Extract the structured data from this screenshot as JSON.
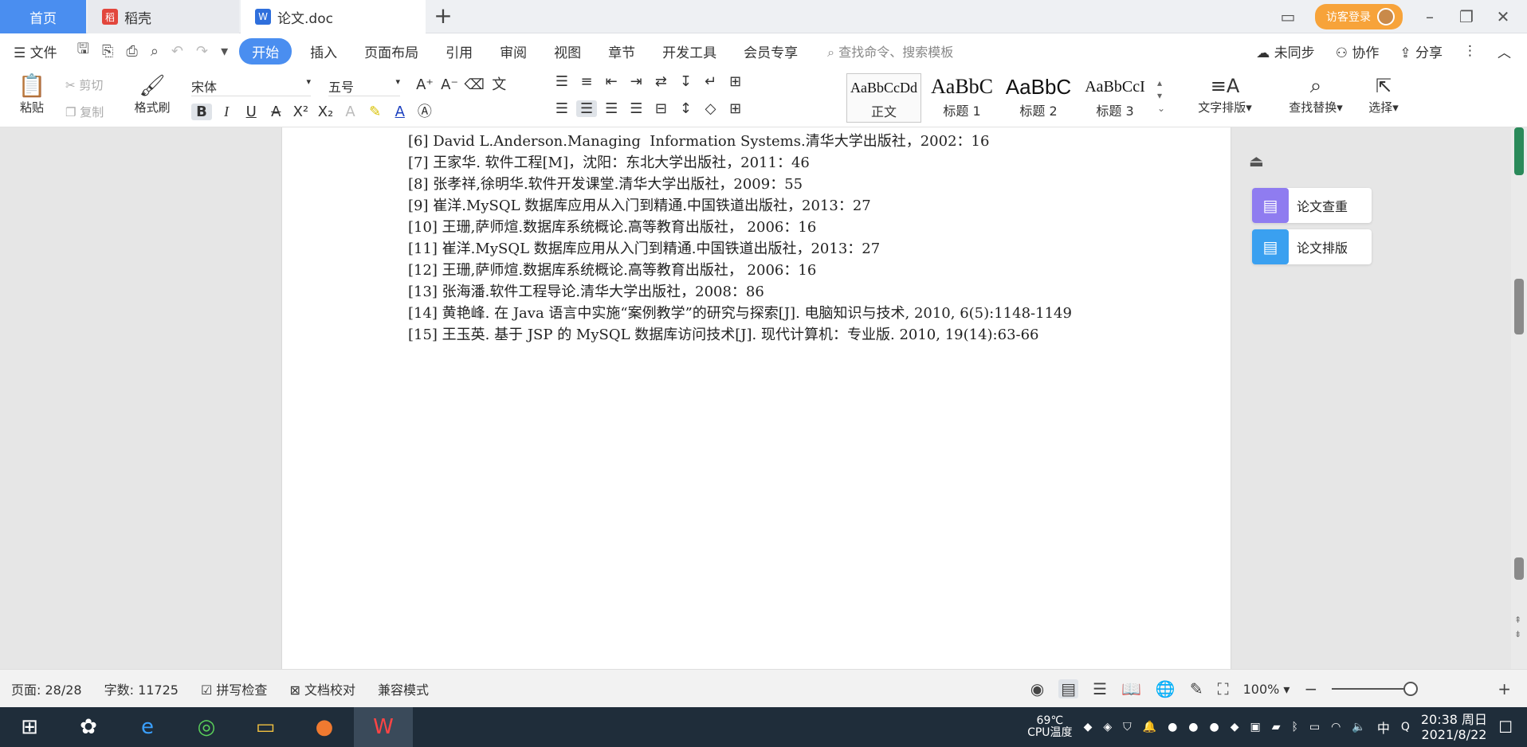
{
  "tabs": {
    "home": "首页",
    "daoke": "稻壳",
    "doc": "论文.doc",
    "new_tab": "+"
  },
  "account": {
    "label": "访客登录"
  },
  "menu": {
    "file": "文件",
    "items": [
      "开始",
      "插入",
      "页面布局",
      "引用",
      "审阅",
      "视图",
      "章节",
      "开发工具",
      "会员专享"
    ],
    "search_placeholder": "查找命令、搜索模板",
    "sync": "未同步",
    "collab": "协作",
    "share": "分享"
  },
  "ribbon": {
    "paste": "粘贴",
    "cut": "剪切",
    "copy": "复制",
    "format_painter": "格式刷",
    "font_name": "宋体",
    "font_size": "五号",
    "styles": [
      {
        "preview": "AaBbCcDd",
        "label": "正文"
      },
      {
        "preview": "AaBbC",
        "label": "标题 1"
      },
      {
        "preview": "AaBbC",
        "label": "标题 2"
      },
      {
        "preview": "AaBbCcI",
        "label": "标题 3"
      }
    ],
    "text_layout": "文字排版",
    "find_replace": "查找替换",
    "select": "选择"
  },
  "document": {
    "references": [
      "[6] David L.Anderson.Managing  Information Systems.清华大学出版社，2002：16",
      "[7] 王家华. 软件工程[M]，沈阳：东北大学出版社，2011：46",
      "[8] 张孝祥,徐明华.软件开发课堂.清华大学出版社，2009：55",
      "[9] 崔洋.MySQL 数据库应用从入门到精通.中国铁道出版社，2013：27",
      "[10] 王珊,萨师煊.数据库系统概论.高等教育出版社， 2006：16",
      "[11] 崔洋.MySQL 数据库应用从入门到精通.中国铁道出版社，2013：27",
      "[12] 王珊,萨师煊.数据库系统概论.高等教育出版社， 2006：16",
      "[13] 张海潘.软件工程导论.清华大学出版社，2008：86",
      "[14] 黄艳峰. 在 Java 语言中实施“案例教学”的研究与探索[J]. 电脑知识与技术, 2010, 6(5):1148-1149",
      "[15] 王玉英. 基于 JSP 的 MySQL 数据库访问技术[J]. 现代计算机：专业版. 2010, 19(14):63-66"
    ]
  },
  "side_panel": {
    "check": "论文查重",
    "format": "论文排版"
  },
  "status": {
    "page": "页面: 28/28",
    "words": "字数: 11725",
    "spell": "拼写检查",
    "proof": "文档校对",
    "compat": "兼容模式",
    "zoom": "100%"
  },
  "taskbar": {
    "cpu_temp": "69℃",
    "cpu_label": "CPU温度",
    "ime": "中",
    "time": "20:38 周日",
    "date": "2021/8/22"
  }
}
